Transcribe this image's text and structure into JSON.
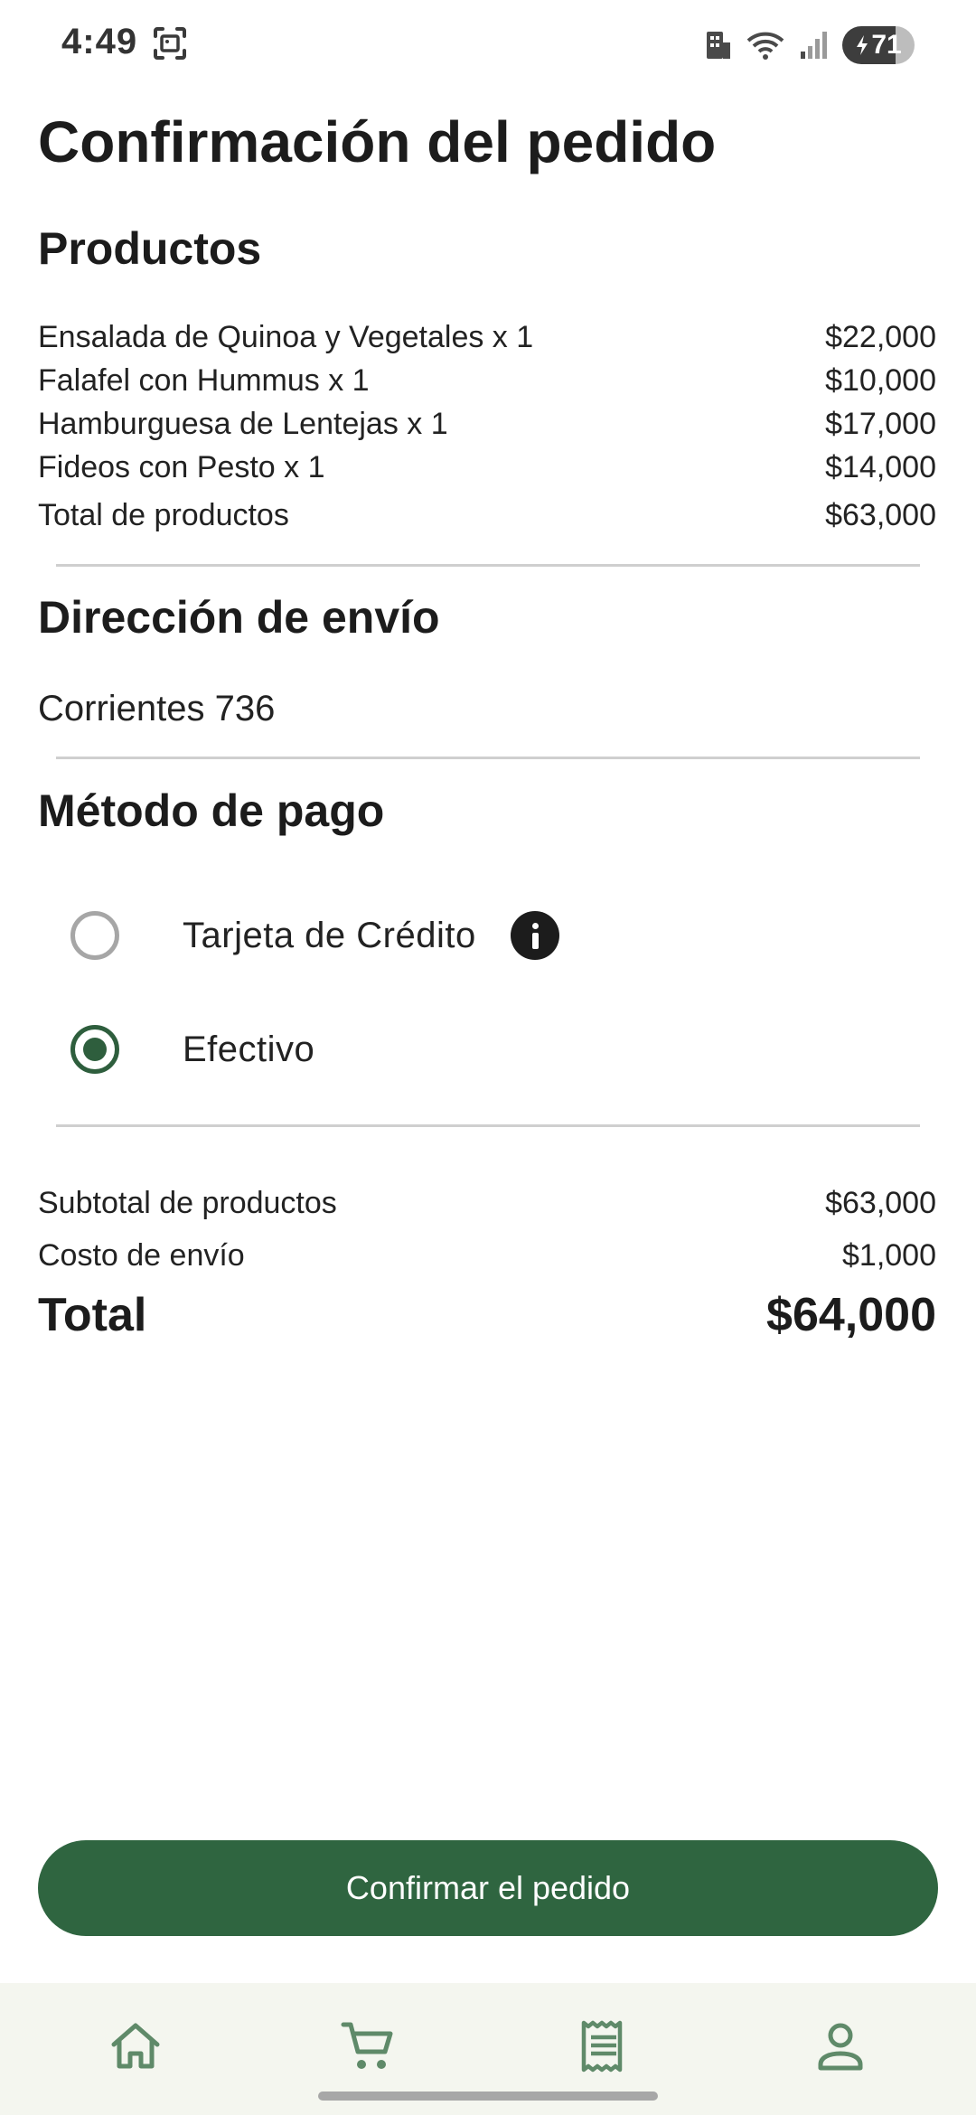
{
  "status_bar": {
    "time": "4:49",
    "battery": "71",
    "icons": [
      "screenshot-icon",
      "building-icon",
      "wifi-icon",
      "signal-icon",
      "battery-icon"
    ]
  },
  "page": {
    "title": "Confirmación del pedido"
  },
  "products": {
    "title": "Productos",
    "items": [
      {
        "name": "Ensalada de Quinoa y Vegetales x 1",
        "price": "$22,000"
      },
      {
        "name": "Falafel con Hummus x 1",
        "price": "$10,000"
      },
      {
        "name": "Hamburguesa de Lentejas x 1",
        "price": "$17,000"
      },
      {
        "name": "Fideos con Pesto x 1",
        "price": "$14,000"
      }
    ],
    "total_label": "Total de productos",
    "total_value": "$63,000"
  },
  "shipping": {
    "title": "Dirección de envío",
    "address": "Corrientes 736"
  },
  "payment": {
    "title": "Método de pago",
    "options": [
      {
        "label": "Tarjeta de Crédito",
        "selected": false
      },
      {
        "label": "Efectivo",
        "selected": true
      }
    ]
  },
  "summary": {
    "subtotal_label": "Subtotal de productos",
    "subtotal_value": "$63,000",
    "shipping_label": "Costo de envío",
    "shipping_value": "$1,000",
    "total_label": "Total",
    "total_value": "$64,000"
  },
  "actions": {
    "confirm_label": "Confirmar el pedido"
  },
  "bottom_nav": {
    "items": [
      "home-icon",
      "cart-icon",
      "receipt-icon",
      "profile-icon"
    ]
  },
  "colors": {
    "accent": "#2f6540",
    "nav_background": "#f4f6ef",
    "nav_icon": "#5f8a69"
  }
}
